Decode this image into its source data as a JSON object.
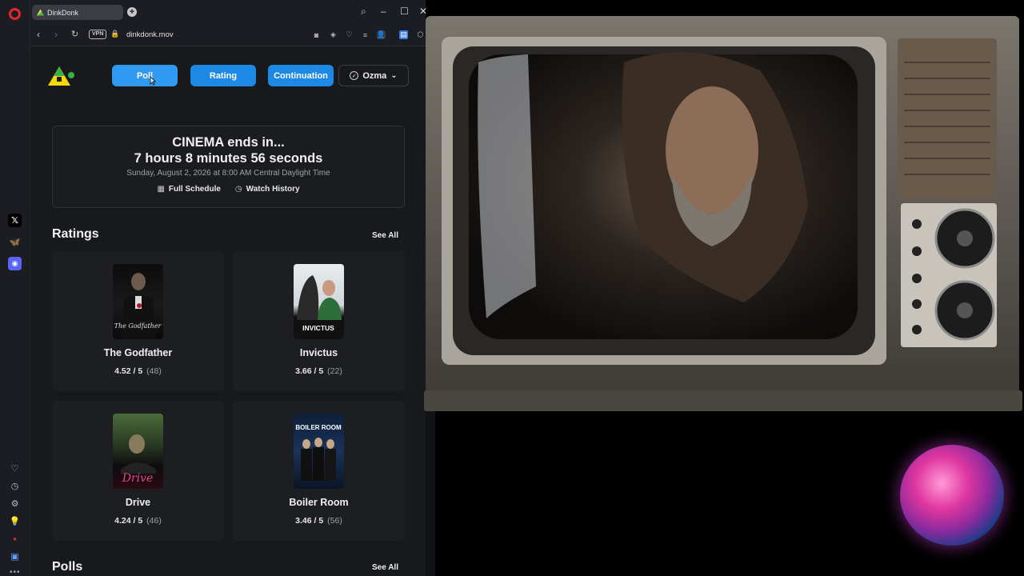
{
  "browser": {
    "tab_title": "DinkDonk",
    "url": "dinkdonk.mov",
    "vpn_label": "VPN"
  },
  "nav": {
    "poll_label": "Poll",
    "rating_label": "Rating",
    "continuation_label": "Continuation",
    "user_label": "Ozma"
  },
  "cinema": {
    "heading": "CINEMA ends in...",
    "countdown": "7 hours 8 minutes 56 seconds",
    "datetime": "Sunday, August 2, 2026 at 8:00 AM Central Daylight Time",
    "full_schedule": "Full Schedule",
    "watch_history": "Watch History"
  },
  "ratings": {
    "heading": "Ratings",
    "see_all": "See All",
    "items": [
      {
        "title": "The Godfather",
        "score": "4.52 / 5",
        "count": "(48)"
      },
      {
        "title": "Invictus",
        "score": "3.66 / 5",
        "count": "(22)",
        "poster_text": "INVICTUS"
      },
      {
        "title": "Drive",
        "score": "4.24 / 5",
        "count": "(46)",
        "poster_text": "Drive"
      },
      {
        "title": "Boiler Room",
        "score": "3.46 / 5",
        "count": "(56)",
        "poster_text": "BOILER ROOM"
      }
    ]
  },
  "polls": {
    "heading": "Polls",
    "see_all": "See All"
  },
  "colors": {
    "accent": "#1e88e5",
    "page_bg": "#17191c",
    "card_bg": "#1c1e21"
  }
}
